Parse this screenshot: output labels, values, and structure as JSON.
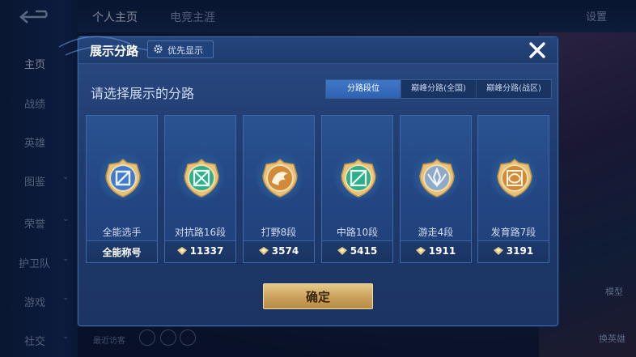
{
  "sidebar": {
    "items": [
      {
        "label": "主页",
        "chevron": false,
        "active": true
      },
      {
        "label": "战绩",
        "chevron": false
      },
      {
        "label": "英雄",
        "chevron": false
      },
      {
        "label": "图鉴",
        "chevron": true
      },
      {
        "label": "荣誉",
        "chevron": true
      },
      {
        "label": "护卫队",
        "chevron": true
      },
      {
        "label": "游戏",
        "chevron": true
      },
      {
        "label": "社交",
        "chevron": true
      }
    ]
  },
  "topnav": {
    "tabs": [
      "个人主页",
      "电竞主涯"
    ],
    "settings": "设置"
  },
  "dialog": {
    "title": "展示分路",
    "priority_label": "优先显示",
    "prompt": "请选择展示的分路",
    "segments": [
      "分路段位",
      "巅峰分路(全国)",
      "巅峰分路(战区)"
    ],
    "selected_segment": 0,
    "cards": [
      {
        "position": "全能选手",
        "value": "全能称号",
        "show_diamond": false,
        "badge": "all-round-badge-icon",
        "color": "#3f7bd0"
      },
      {
        "position": "对抗路16段",
        "value": "11337",
        "show_diamond": true,
        "badge": "clash-lane-badge-icon",
        "color": "#2fae8a"
      },
      {
        "position": "打野8段",
        "value": "3574",
        "show_diamond": true,
        "badge": "jungle-badge-icon",
        "color": "#d08a3a"
      },
      {
        "position": "中路10段",
        "value": "5415",
        "show_diamond": true,
        "badge": "mid-lane-badge-icon",
        "color": "#2fae8a"
      },
      {
        "position": "游走4段",
        "value": "1911",
        "show_diamond": true,
        "badge": "roam-badge-icon",
        "color": "#8fa9c9"
      },
      {
        "position": "发育路7段",
        "value": "3191",
        "show_diamond": true,
        "badge": "farm-lane-badge-icon",
        "color": "#d08a3a"
      }
    ],
    "confirm_label": "确定"
  },
  "background": {
    "visitor_label": "最近访客",
    "bottom_right_1": "模型",
    "bottom_right_2": "换英雄"
  },
  "colors": {
    "accent": "#2f63b2",
    "gold": "#c9a15a"
  }
}
